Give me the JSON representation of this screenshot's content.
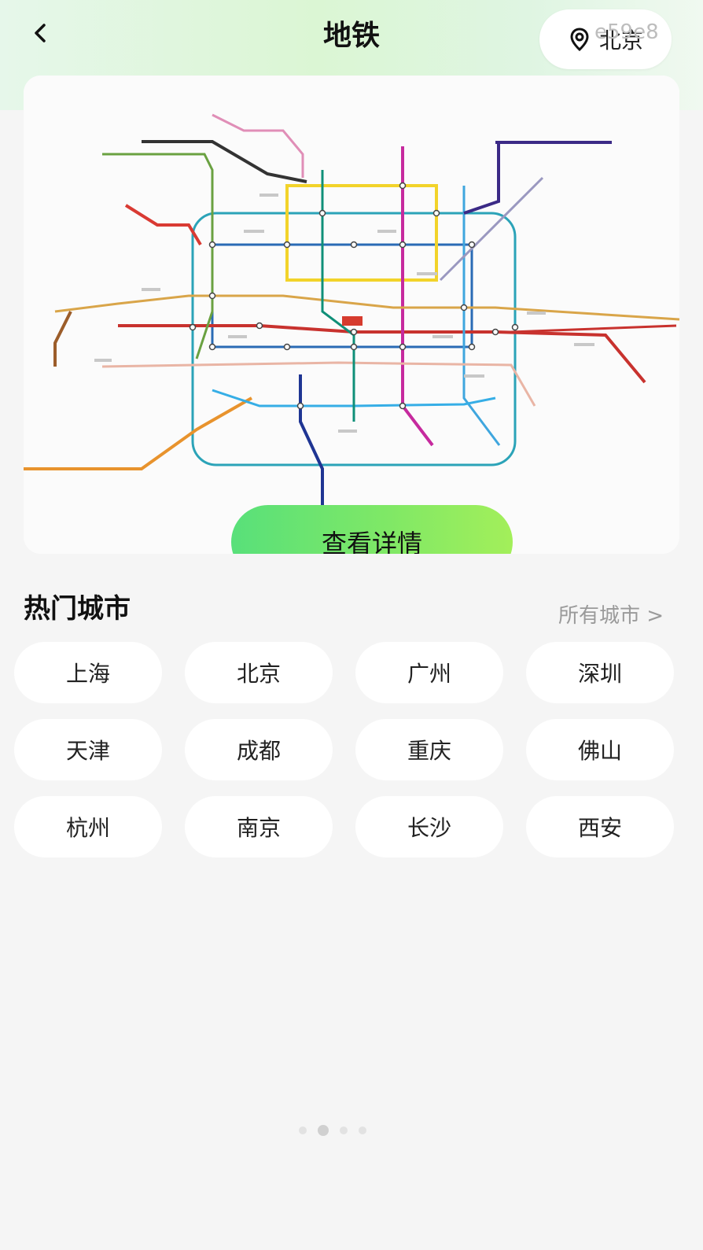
{
  "header": {
    "title": "地铁",
    "location": "北京",
    "watermark": "e59e8"
  },
  "map": {
    "details_button": "查看详情"
  },
  "hot_cities": {
    "title": "热门城市",
    "all_link": "所有城市 >",
    "cities": [
      "上海",
      "北京",
      "广州",
      "深圳",
      "天津",
      "成都",
      "重庆",
      "佛山",
      "杭州",
      "南京",
      "长沙",
      "西安"
    ]
  },
  "icons": {
    "back": "back-chevron-icon",
    "location": "location-pin-icon"
  },
  "colors": {
    "accent_start": "#58e07a",
    "accent_end": "#a3ef5a"
  }
}
